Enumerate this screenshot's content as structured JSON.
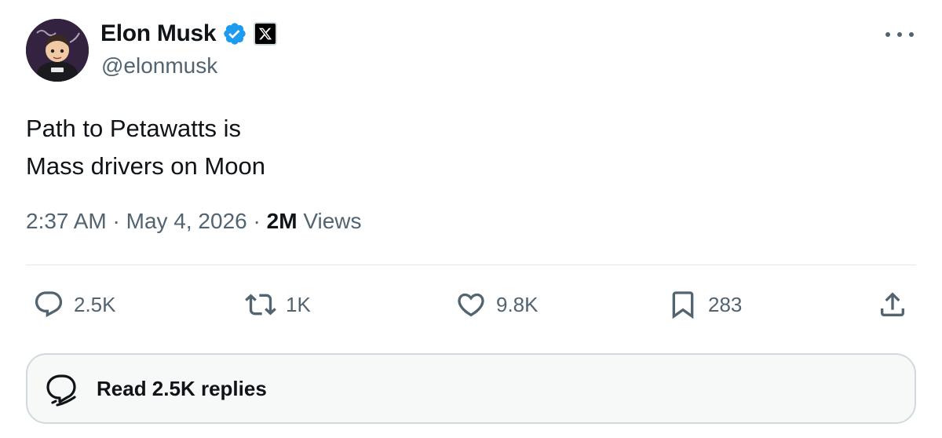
{
  "author": {
    "display_name": "Elon Musk",
    "handle": "@elonmusk",
    "verified": true,
    "affiliate_badge": "x-logo-icon"
  },
  "tweet": {
    "lines": [
      "Path to Petawatts is",
      "Mass drivers on Moon"
    ]
  },
  "meta": {
    "time": "2:37 AM",
    "separator": "·",
    "date": "May 4, 2026",
    "views_count": "2M",
    "views_label": "Views"
  },
  "actions": {
    "replies": "2.5K",
    "reposts": "1K",
    "likes": "9.8K",
    "bookmarks": "283"
  },
  "read_replies_label": "Read 2.5K replies",
  "colors": {
    "text_primary": "#0f1419",
    "text_secondary": "#536471",
    "verified_blue": "#1d9bf0",
    "divider": "#e1e8ed"
  },
  "icons": [
    "verified-badge-icon",
    "x-logo-icon",
    "more-icon",
    "reply-icon",
    "repost-icon",
    "like-icon",
    "bookmark-icon",
    "share-icon",
    "replies-bubble-icon"
  ]
}
